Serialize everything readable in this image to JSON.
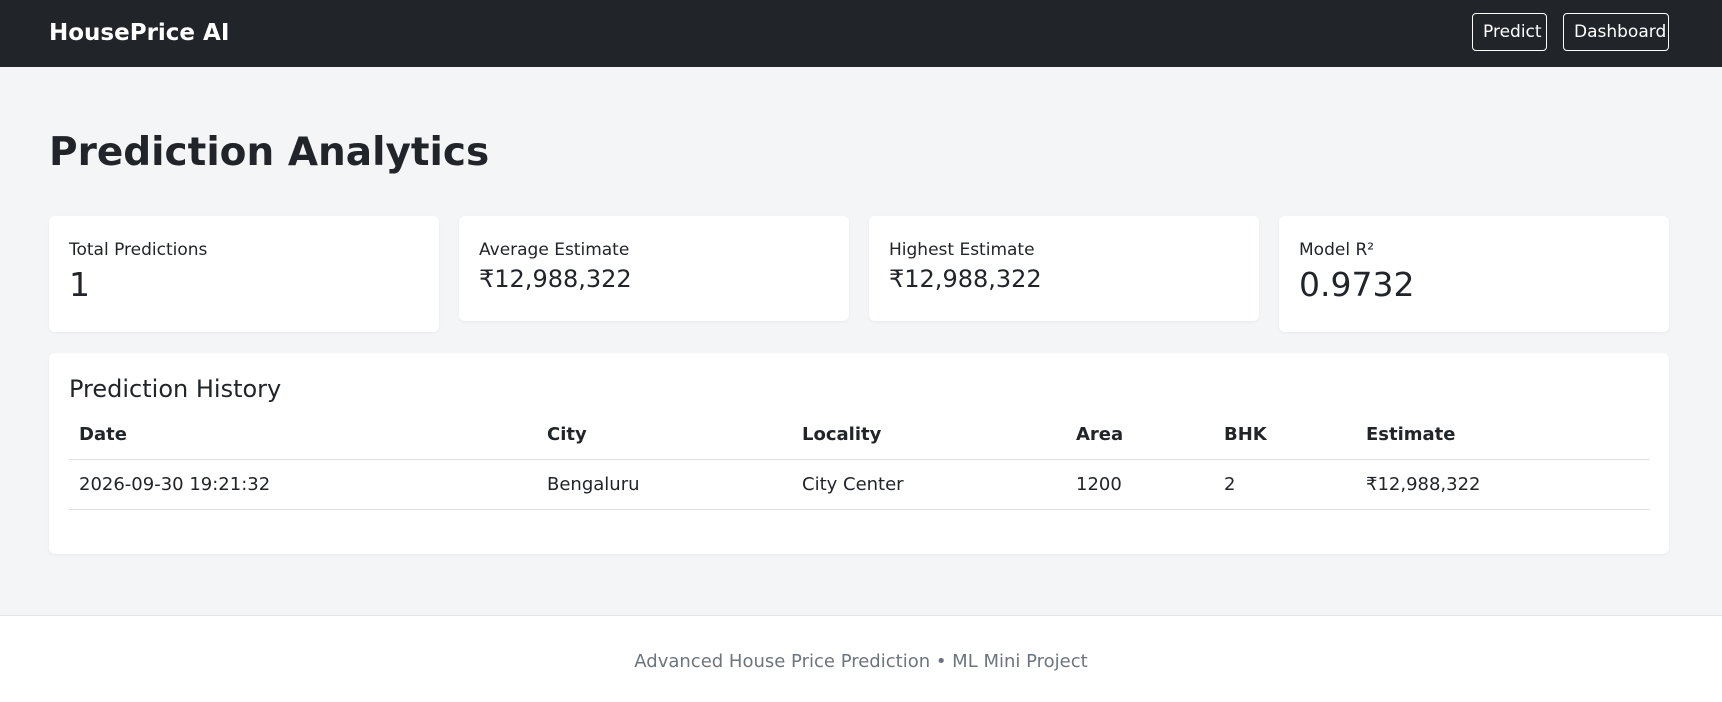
{
  "navbar": {
    "brand": "HousePrice AI",
    "predict_label": "Predict",
    "dashboard_label": "Dashboard"
  },
  "page": {
    "title": "Prediction Analytics"
  },
  "stats": {
    "total_predictions": {
      "label": "Total Predictions",
      "value": "1"
    },
    "average_estimate": {
      "label": "Average Estimate",
      "value": "₹12,988,322"
    },
    "highest_estimate": {
      "label": "Highest Estimate",
      "value": "₹12,988,322"
    },
    "model_r2": {
      "label": "Model R²",
      "value": "0.9732"
    }
  },
  "history": {
    "title": "Prediction History",
    "columns": [
      "Date",
      "City",
      "Locality",
      "Area",
      "BHK",
      "Estimate"
    ],
    "rows": [
      [
        "2026-09-30 19:21:32",
        "Bengaluru",
        "City Center",
        "1200",
        "2",
        "₹12,988,322"
      ]
    ]
  },
  "footer": {
    "text": "Advanced House Price Prediction • ML Mini Project"
  },
  "colors": {
    "navbar_bg": "#212529",
    "page_bg": "#f4f5f7",
    "card_bg": "#ffffff",
    "muted_text": "#6c757d"
  }
}
